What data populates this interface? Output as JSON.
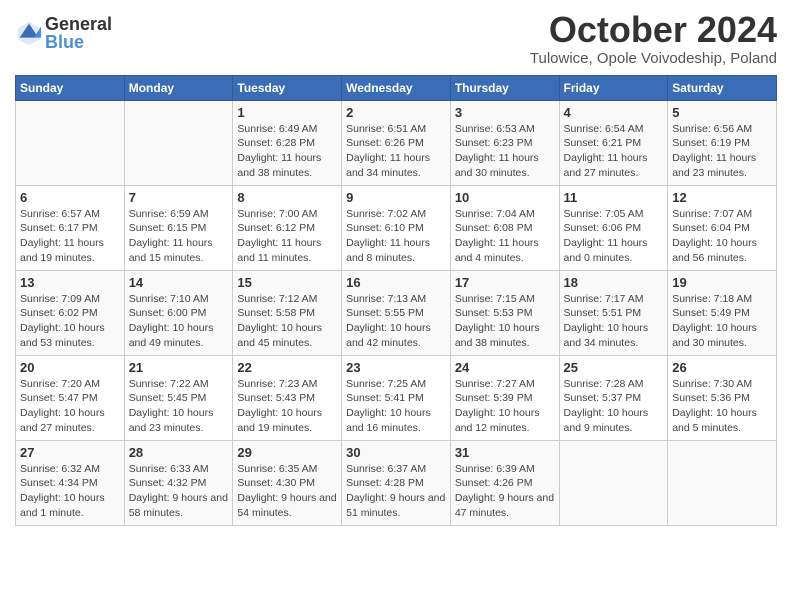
{
  "logo": {
    "general": "General",
    "blue": "Blue"
  },
  "title": "October 2024",
  "subtitle": "Tulowice, Opole Voivodeship, Poland",
  "headers": [
    "Sunday",
    "Monday",
    "Tuesday",
    "Wednesday",
    "Thursday",
    "Friday",
    "Saturday"
  ],
  "weeks": [
    [
      {
        "day": "",
        "sunrise": "",
        "sunset": "",
        "daylight": ""
      },
      {
        "day": "",
        "sunrise": "",
        "sunset": "",
        "daylight": ""
      },
      {
        "day": "1",
        "sunrise": "Sunrise: 6:49 AM",
        "sunset": "Sunset: 6:28 PM",
        "daylight": "Daylight: 11 hours and 38 minutes."
      },
      {
        "day": "2",
        "sunrise": "Sunrise: 6:51 AM",
        "sunset": "Sunset: 6:26 PM",
        "daylight": "Daylight: 11 hours and 34 minutes."
      },
      {
        "day": "3",
        "sunrise": "Sunrise: 6:53 AM",
        "sunset": "Sunset: 6:23 PM",
        "daylight": "Daylight: 11 hours and 30 minutes."
      },
      {
        "day": "4",
        "sunrise": "Sunrise: 6:54 AM",
        "sunset": "Sunset: 6:21 PM",
        "daylight": "Daylight: 11 hours and 27 minutes."
      },
      {
        "day": "5",
        "sunrise": "Sunrise: 6:56 AM",
        "sunset": "Sunset: 6:19 PM",
        "daylight": "Daylight: 11 hours and 23 minutes."
      }
    ],
    [
      {
        "day": "6",
        "sunrise": "Sunrise: 6:57 AM",
        "sunset": "Sunset: 6:17 PM",
        "daylight": "Daylight: 11 hours and 19 minutes."
      },
      {
        "day": "7",
        "sunrise": "Sunrise: 6:59 AM",
        "sunset": "Sunset: 6:15 PM",
        "daylight": "Daylight: 11 hours and 15 minutes."
      },
      {
        "day": "8",
        "sunrise": "Sunrise: 7:00 AM",
        "sunset": "Sunset: 6:12 PM",
        "daylight": "Daylight: 11 hours and 11 minutes."
      },
      {
        "day": "9",
        "sunrise": "Sunrise: 7:02 AM",
        "sunset": "Sunset: 6:10 PM",
        "daylight": "Daylight: 11 hours and 8 minutes."
      },
      {
        "day": "10",
        "sunrise": "Sunrise: 7:04 AM",
        "sunset": "Sunset: 6:08 PM",
        "daylight": "Daylight: 11 hours and 4 minutes."
      },
      {
        "day": "11",
        "sunrise": "Sunrise: 7:05 AM",
        "sunset": "Sunset: 6:06 PM",
        "daylight": "Daylight: 11 hours and 0 minutes."
      },
      {
        "day": "12",
        "sunrise": "Sunrise: 7:07 AM",
        "sunset": "Sunset: 6:04 PM",
        "daylight": "Daylight: 10 hours and 56 minutes."
      }
    ],
    [
      {
        "day": "13",
        "sunrise": "Sunrise: 7:09 AM",
        "sunset": "Sunset: 6:02 PM",
        "daylight": "Daylight: 10 hours and 53 minutes."
      },
      {
        "day": "14",
        "sunrise": "Sunrise: 7:10 AM",
        "sunset": "Sunset: 6:00 PM",
        "daylight": "Daylight: 10 hours and 49 minutes."
      },
      {
        "day": "15",
        "sunrise": "Sunrise: 7:12 AM",
        "sunset": "Sunset: 5:58 PM",
        "daylight": "Daylight: 10 hours and 45 minutes."
      },
      {
        "day": "16",
        "sunrise": "Sunrise: 7:13 AM",
        "sunset": "Sunset: 5:55 PM",
        "daylight": "Daylight: 10 hours and 42 minutes."
      },
      {
        "day": "17",
        "sunrise": "Sunrise: 7:15 AM",
        "sunset": "Sunset: 5:53 PM",
        "daylight": "Daylight: 10 hours and 38 minutes."
      },
      {
        "day": "18",
        "sunrise": "Sunrise: 7:17 AM",
        "sunset": "Sunset: 5:51 PM",
        "daylight": "Daylight: 10 hours and 34 minutes."
      },
      {
        "day": "19",
        "sunrise": "Sunrise: 7:18 AM",
        "sunset": "Sunset: 5:49 PM",
        "daylight": "Daylight: 10 hours and 30 minutes."
      }
    ],
    [
      {
        "day": "20",
        "sunrise": "Sunrise: 7:20 AM",
        "sunset": "Sunset: 5:47 PM",
        "daylight": "Daylight: 10 hours and 27 minutes."
      },
      {
        "day": "21",
        "sunrise": "Sunrise: 7:22 AM",
        "sunset": "Sunset: 5:45 PM",
        "daylight": "Daylight: 10 hours and 23 minutes."
      },
      {
        "day": "22",
        "sunrise": "Sunrise: 7:23 AM",
        "sunset": "Sunset: 5:43 PM",
        "daylight": "Daylight: 10 hours and 19 minutes."
      },
      {
        "day": "23",
        "sunrise": "Sunrise: 7:25 AM",
        "sunset": "Sunset: 5:41 PM",
        "daylight": "Daylight: 10 hours and 16 minutes."
      },
      {
        "day": "24",
        "sunrise": "Sunrise: 7:27 AM",
        "sunset": "Sunset: 5:39 PM",
        "daylight": "Daylight: 10 hours and 12 minutes."
      },
      {
        "day": "25",
        "sunrise": "Sunrise: 7:28 AM",
        "sunset": "Sunset: 5:37 PM",
        "daylight": "Daylight: 10 hours and 9 minutes."
      },
      {
        "day": "26",
        "sunrise": "Sunrise: 7:30 AM",
        "sunset": "Sunset: 5:36 PM",
        "daylight": "Daylight: 10 hours and 5 minutes."
      }
    ],
    [
      {
        "day": "27",
        "sunrise": "Sunrise: 6:32 AM",
        "sunset": "Sunset: 4:34 PM",
        "daylight": "Daylight: 10 hours and 1 minute."
      },
      {
        "day": "28",
        "sunrise": "Sunrise: 6:33 AM",
        "sunset": "Sunset: 4:32 PM",
        "daylight": "Daylight: 9 hours and 58 minutes."
      },
      {
        "day": "29",
        "sunrise": "Sunrise: 6:35 AM",
        "sunset": "Sunset: 4:30 PM",
        "daylight": "Daylight: 9 hours and 54 minutes."
      },
      {
        "day": "30",
        "sunrise": "Sunrise: 6:37 AM",
        "sunset": "Sunset: 4:28 PM",
        "daylight": "Daylight: 9 hours and 51 minutes."
      },
      {
        "day": "31",
        "sunrise": "Sunrise: 6:39 AM",
        "sunset": "Sunset: 4:26 PM",
        "daylight": "Daylight: 9 hours and 47 minutes."
      },
      {
        "day": "",
        "sunrise": "",
        "sunset": "",
        "daylight": ""
      },
      {
        "day": "",
        "sunrise": "",
        "sunset": "",
        "daylight": ""
      }
    ]
  ]
}
